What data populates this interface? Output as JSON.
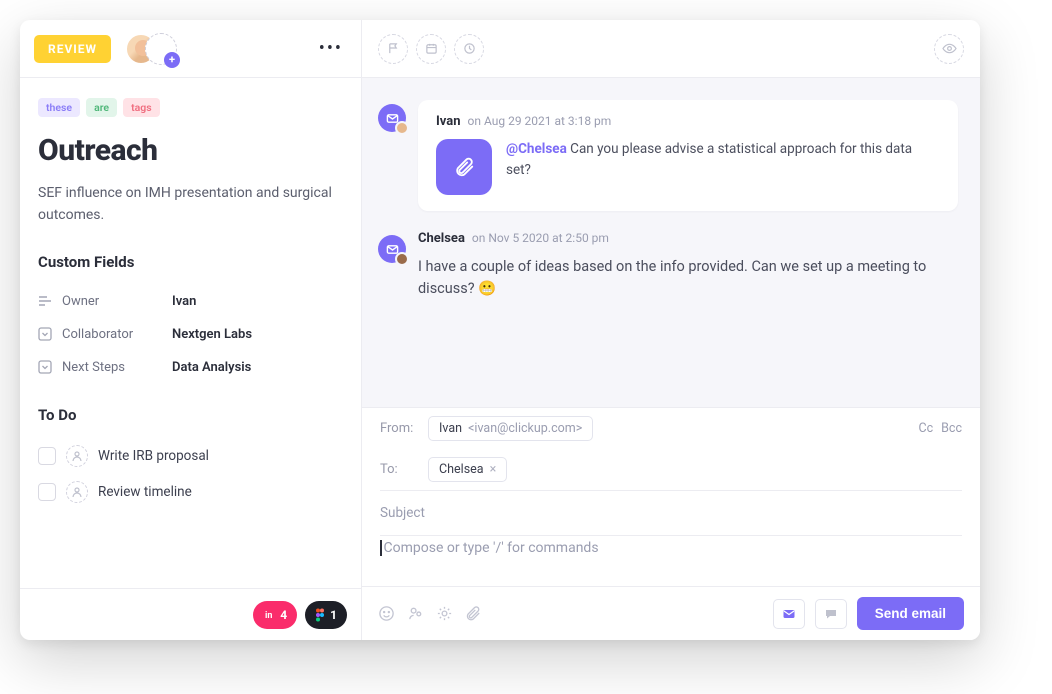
{
  "left": {
    "status_label": "REVIEW",
    "tags": [
      "these",
      "are",
      "tags"
    ],
    "title": "Outreach",
    "description": "SEF influence on IMH presentation and surgical outcomes.",
    "custom_fields_header": "Custom Fields",
    "custom_fields": [
      {
        "icon": "lines-icon",
        "label": "Owner",
        "value": "Ivan"
      },
      {
        "icon": "dropdown-icon",
        "label": "Collaborator",
        "value": "Nextgen Labs"
      },
      {
        "icon": "dropdown-icon",
        "label": "Next Steps",
        "value": "Data Analysis"
      }
    ],
    "todo_header": "To Do",
    "todos": [
      {
        "label": "Write IRB proposal"
      },
      {
        "label": "Review timeline"
      }
    ],
    "footer_pills": [
      {
        "icon": "invision-icon",
        "count": "4",
        "style": "pink"
      },
      {
        "icon": "figma-icon",
        "count": "1",
        "style": "dark"
      }
    ]
  },
  "thread": {
    "messages": [
      {
        "author": "Ivan",
        "meta": "on Aug 29 2021 at 3:18 pm",
        "mention": "@Chelsea",
        "text": " Can you please advise a statistical approach for this data set?",
        "has_attachment": true
      },
      {
        "author": "Chelsea",
        "meta": "on Nov 5 2020 at 2:50 pm",
        "text": "I have a couple of ideas based on the info provided. Can we set up a meeting to discuss? 😬",
        "has_attachment": false
      }
    ]
  },
  "compose": {
    "from_label": "From:",
    "from_name": "Ivan",
    "from_email": "<ivan@clickup.com>",
    "to_label": "To:",
    "to_chip": "Chelsea",
    "cc_label": "Cc",
    "bcc_label": "Bcc",
    "subject_placeholder": "Subject",
    "body_placeholder": "Compose or type '/' for commands",
    "send_label": "Send email"
  }
}
